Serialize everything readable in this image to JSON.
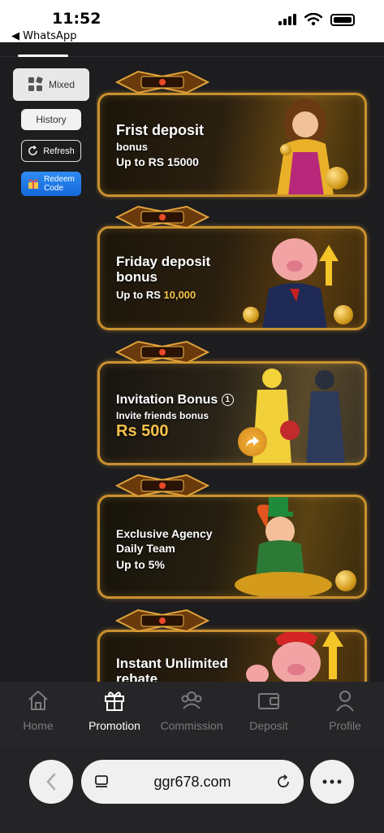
{
  "status_bar": {
    "time": "11:52",
    "back_label": "◀ WhatsApp"
  },
  "sidebar": {
    "mixed_label": "Mixed",
    "history_label": "History",
    "refresh_label": "Refresh",
    "redeem_label_line1": "Redeem",
    "redeem_label_line2": "Code"
  },
  "banners": [
    {
      "title": "Frist deposit",
      "sub": "bonus",
      "sub2": "Up to RS 15000"
    },
    {
      "title": "Friday deposit",
      "title2": "bonus",
      "sub_prefix": "Up to RS ",
      "sub_highlight": "10,000"
    },
    {
      "title": "Invitation Bonus",
      "info": "1",
      "sub": "Invite friends bonus",
      "big": "Rs 500"
    },
    {
      "title": "Exclusive Agency",
      "title2": "Daily Team",
      "sub": "Up to 5%"
    },
    {
      "title": "Instant Unlimited",
      "title2": "rebate"
    }
  ],
  "nav": {
    "items": [
      {
        "label": "Home",
        "icon": "home-icon"
      },
      {
        "label": "Promotion",
        "icon": "gift-icon"
      },
      {
        "label": "Commission",
        "icon": "people-icon"
      },
      {
        "label": "Deposit",
        "icon": "wallet-icon"
      },
      {
        "label": "Profile",
        "icon": "person-icon"
      }
    ],
    "active": "Promotion"
  },
  "browser": {
    "url": "ggr678.com"
  },
  "colors": {
    "accent_gold": "#c9912e",
    "active_nav": "#ffffff",
    "inactive_nav": "#7b7b7e",
    "redeem_blue": "#1f7be6"
  }
}
